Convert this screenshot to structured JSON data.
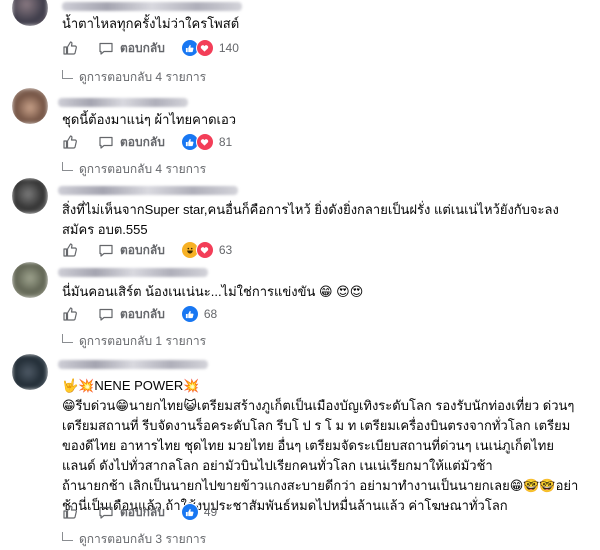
{
  "comments": [
    {
      "text": "น้ำตาไหลทุกครั้งไม่ว่าใครโพสต์",
      "reply_label": "ตอบกลับ",
      "reaction_count": "140",
      "view_replies": "ดูการตอบกลับ 4 รายการ"
    },
    {
      "text": "ชุดนี้ต้องมาแน่ๆ ผ้าไทยคาดเอว",
      "reply_label": "ตอบกลับ",
      "reaction_count": "81",
      "view_replies": "ดูการตอบกลับ 4 รายการ"
    },
    {
      "text": "สิ่งที่ไม่เห็นจากSuper star,คนอื่นก็คือการไหว้ ยิ่งดังยิ่งกลายเป็นฝรั่ง แต่เนเน่ไหว้ยังกับจะลงสมัคร อบต.555",
      "reply_label": "ตอบกลับ",
      "reaction_count": "63",
      "view_replies": ""
    },
    {
      "text": "นี่มันคอนเสิร์ต น้องเนเน่นะ...ไม่ใช่การแข่งขัน",
      "text_emojis": "😁 😍😍",
      "reply_label": "ตอบกลับ",
      "reaction_count": "68",
      "view_replies": "ดูการตอบกลับ 1 รายการ"
    },
    {
      "line1": "🤟💥NENE POWER💥",
      "line2": "😁รีบด่วน😁นายกไทย😺เตรียมสร้างภูเก็ตเป็นเมืองบัญเทิงระดับโลก รองรับนักท่องเที่ยว ด่วนๆ เตรียมสถานที่ รีบจัดงานร็อคระดับโลก รีบโ ป ร โ ม ท เตรียมเครื่องบินตรงจากทั่วโลก เตรียมของดีไทย อาหารไทย ชุดไทย มวยไทย อื่นๆ เตรียมจัดระเบียบสถานที่ด่วนๆ เนเน่ภูเก็ตไทยแลนด์ ดังไปทั่วสากลโลก อย่ามัวบินไปเรียกคนทั่วโลก เนเน่เรียกมาให้แต่มัวช้า",
      "line3": "ถ้านายกช้า เลิกเป็นนายกไปขายข้าวแกงสะบายดีกว่า อย่ามาทำงานเป็นนายกเลย😁🤓🤓อย่าช้านี่เป็นเดือนแล้ว ถ้าใช้งบประชาสัมพันธ์หมดไปหมื่นล้านแล้ว ค่าโฆษณาทั่วโลก",
      "reply_label": "ตอบกลับ",
      "reaction_count": "49",
      "view_replies": "ดูการตอบกลับ 3 รายการ"
    }
  ],
  "icons": {
    "like": "thumbs-up-icon",
    "reply": "speech-bubble-icon",
    "like_reaction": "like-reaction-icon",
    "love_reaction": "love-reaction-icon",
    "haha_reaction": "haha-reaction-icon"
  },
  "colors": {
    "like_blue": "#1877f2",
    "love_red": "#f33e58",
    "haha_yellow": "#f7b125",
    "meta_gray": "#65676b"
  }
}
